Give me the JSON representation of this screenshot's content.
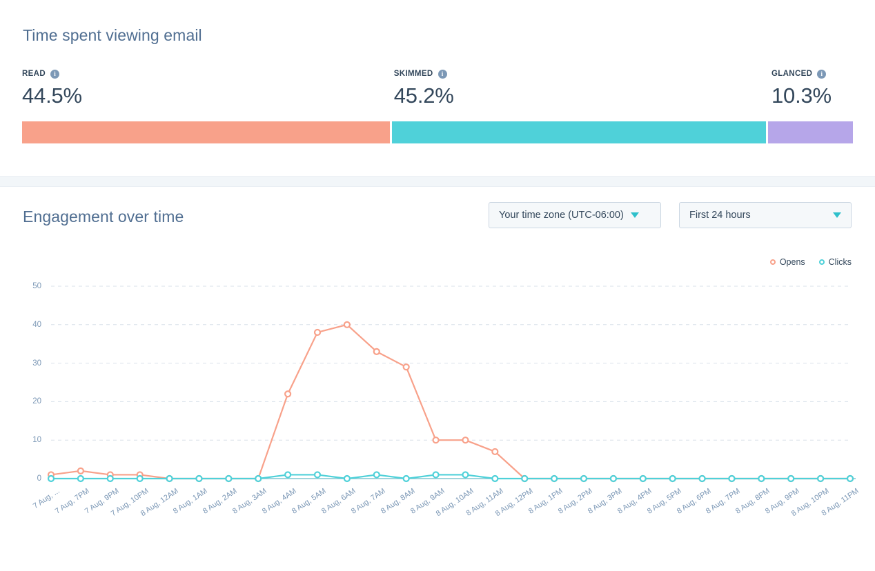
{
  "colors": {
    "read": "#f8a18a",
    "skimmed": "#4fd1d9",
    "glanced": "#b6a6e9",
    "opens": "#f8a18a",
    "clicks": "#4fd1d9",
    "title": "#506e91",
    "text": "#33475b",
    "axis": "#7c98b6",
    "grid": "#cbd6e2",
    "caret": "#2fc0cb",
    "band": "#f2f6f9"
  },
  "time_spent_card": {
    "title": "Time spent viewing email",
    "info_icon": "info-icon",
    "metrics": [
      {
        "label": "READ",
        "value": "44.5%",
        "pct": 44.5,
        "color_key": "read"
      },
      {
        "label": "SKIMMED",
        "value": "45.2%",
        "pct": 45.2,
        "color_key": "skimmed"
      },
      {
        "label": "GLANCED",
        "value": "10.3%",
        "pct": 10.3,
        "color_key": "glanced"
      }
    ]
  },
  "engagement_card": {
    "title": "Engagement over time",
    "timezone_dropdown": {
      "value": "Your time zone (UTC-06:00)",
      "icon": "chevron-down-icon"
    },
    "range_dropdown": {
      "value": "First 24 hours",
      "icon": "chevron-down-icon"
    }
  },
  "chart_data": {
    "type": "line",
    "title": "Engagement over time",
    "xlabel": "",
    "ylabel": "",
    "ylim": [
      0,
      50
    ],
    "yticks": [
      0,
      10,
      20,
      30,
      40,
      50
    ],
    "grid": true,
    "legend_position": "top-right",
    "x": [
      "7 Aug, ...",
      "7 Aug, 7PM",
      "7 Aug, 9PM",
      "7 Aug, 10PM",
      "8 Aug, 12AM",
      "8 Aug, 1AM",
      "8 Aug, 2AM",
      "8 Aug, 3AM",
      "8 Aug, 4AM",
      "8 Aug, 5AM",
      "8 Aug, 6AM",
      "8 Aug, 7AM",
      "8 Aug, 8AM",
      "8 Aug, 9AM",
      "8 Aug, 10AM",
      "8 Aug, 11AM",
      "8 Aug, 12PM",
      "8 Aug, 1PM",
      "8 Aug, 2PM",
      "8 Aug, 3PM",
      "8 Aug, 4PM",
      "8 Aug, 5PM",
      "8 Aug, 6PM",
      "8 Aug, 7PM",
      "8 Aug, 8PM",
      "8 Aug, 9PM",
      "8 Aug, 10PM",
      "8 Aug, 11PM"
    ],
    "series": [
      {
        "name": "Opens",
        "color": "#f8a18a",
        "values": [
          1,
          2,
          1,
          1,
          0,
          0,
          0,
          0,
          22,
          38,
          40,
          33,
          29,
          10,
          10,
          7,
          0,
          0,
          0,
          0,
          0,
          0,
          0,
          0,
          0,
          0,
          0,
          0
        ]
      },
      {
        "name": "Clicks",
        "color": "#4fd1d9",
        "values": [
          0,
          0,
          0,
          0,
          0,
          0,
          0,
          0,
          1,
          1,
          0,
          1,
          0,
          1,
          1,
          0,
          0,
          0,
          0,
          0,
          0,
          0,
          0,
          0,
          0,
          0,
          0,
          0
        ]
      }
    ]
  }
}
